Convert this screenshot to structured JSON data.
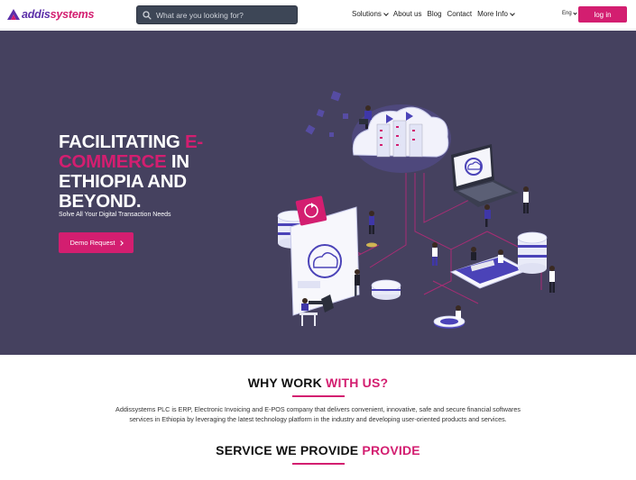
{
  "brand": {
    "name_part1": "addis",
    "name_part2": "systems",
    "primary_color": "#d31e70",
    "secondary_color": "#5b2fa8"
  },
  "nav": {
    "search_placeholder": "What are you looking for?",
    "items": [
      {
        "label": "Solutions",
        "dropdown": true
      },
      {
        "label": "About us",
        "dropdown": false
      },
      {
        "label": "Blog",
        "dropdown": false
      },
      {
        "label": "Contact",
        "dropdown": false
      },
      {
        "label": "More Info",
        "dropdown": true
      }
    ],
    "language": "Eng",
    "login_label": "log in"
  },
  "hero": {
    "title_part1": "FACILITATING ",
    "title_highlight": "E-COMMERCE",
    "title_part2": " IN ETHIOPIA AND BEYOND.",
    "subtitle": "Solve All Your Digital Transaction Needs",
    "cta_label": "Demo Request",
    "background_color": "#45415f"
  },
  "why": {
    "title_part1": "WHY WORK ",
    "title_highlight": "WITH US?",
    "description": "Addissystems PLC is ERP, Electronic Invoicing and E-POS company that delivers convenient, innovative, safe and secure financial softwares services in Ethiopia by leveraging the latest technology platform in the industry and developing user-oriented products and services."
  },
  "services": {
    "title_part1": "SERVICE WE PROVIDE ",
    "title_highlight": "PROVIDE"
  }
}
